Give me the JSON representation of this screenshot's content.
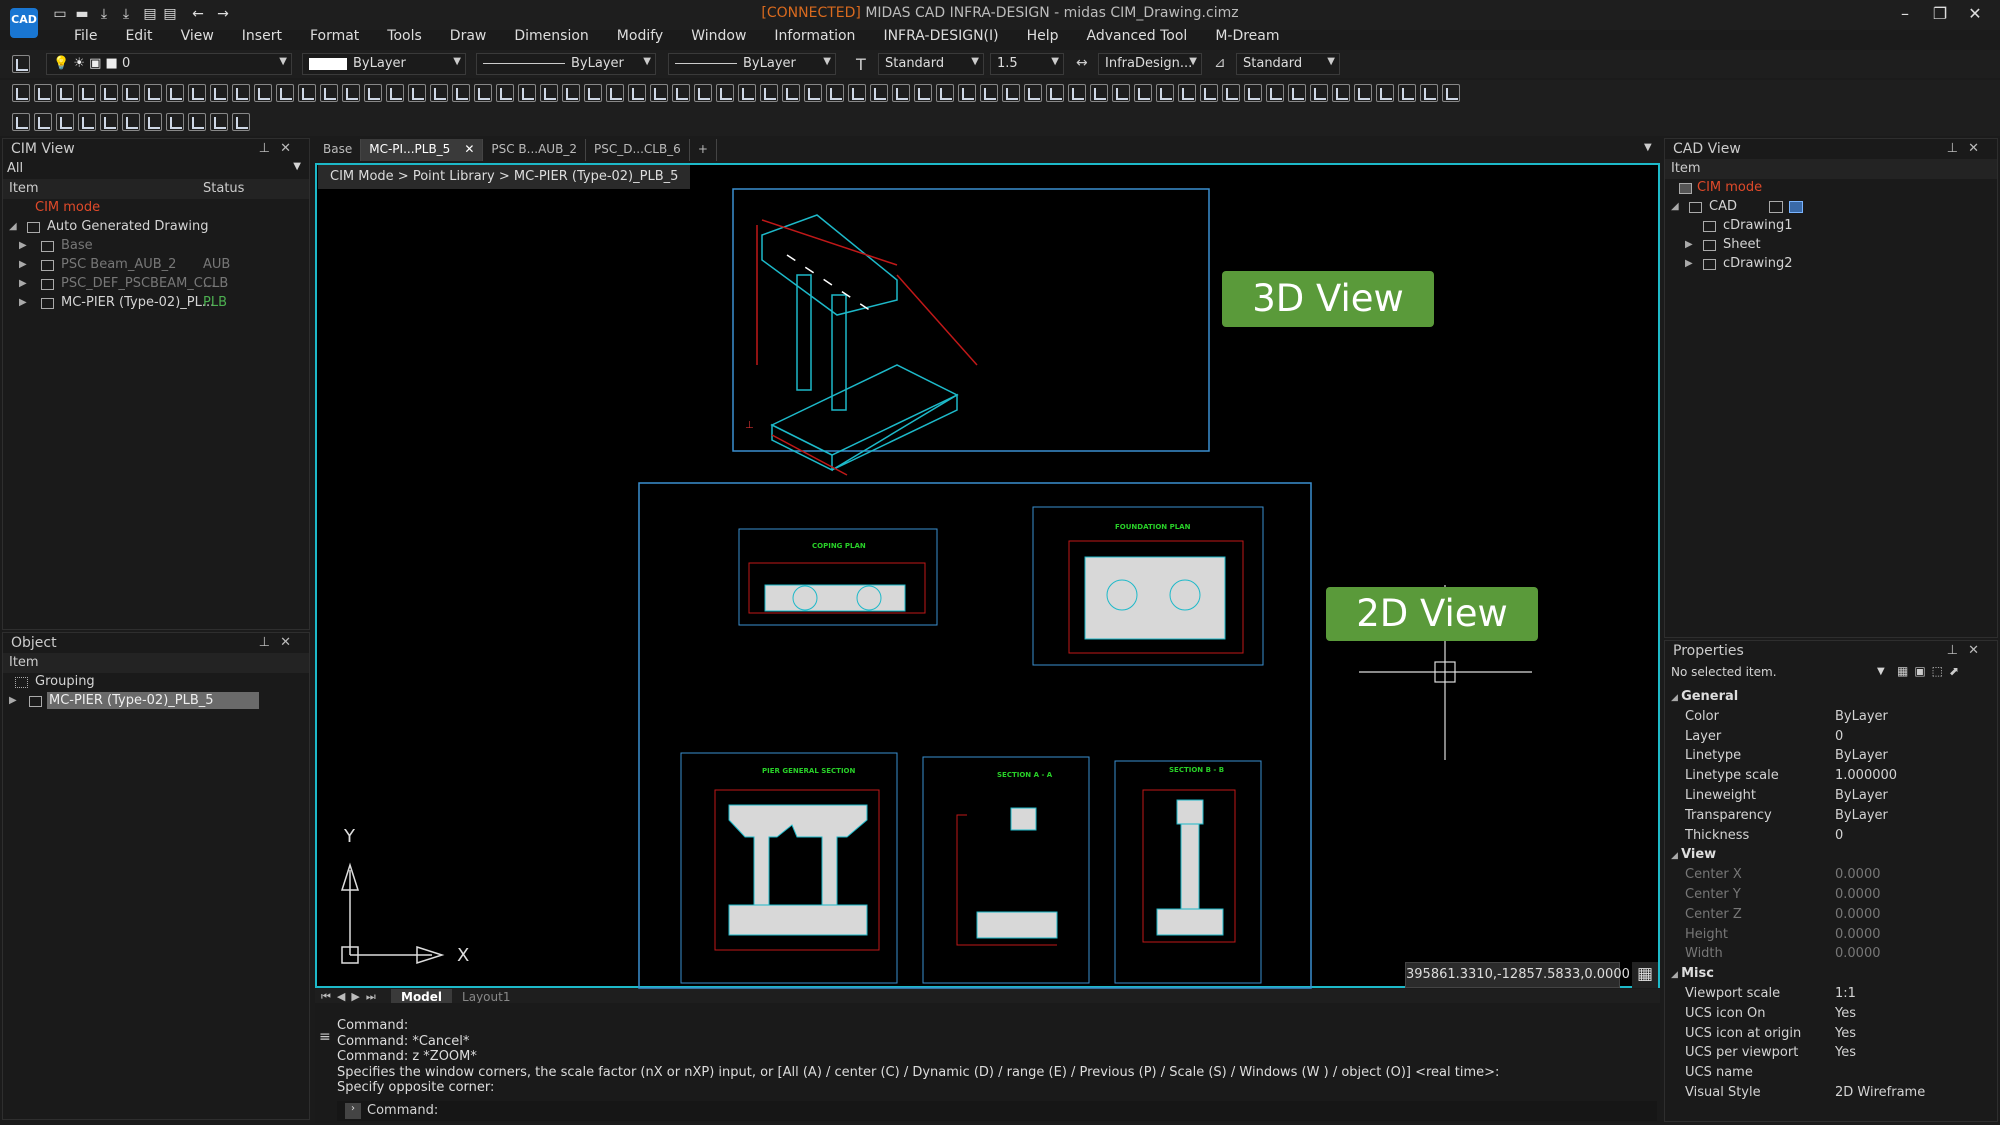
{
  "title": {
    "connected": "[CONNECTED]",
    "app": " MIDAS CAD INFRA-DESIGN - ",
    "file": "midas CIM_Drawing.cimz"
  },
  "logo": "CAD",
  "menu": [
    "File",
    "Edit",
    "View",
    "Insert",
    "Format",
    "Tools",
    "Draw",
    "Dimension",
    "Modify",
    "Window",
    "Information",
    "INFRA-DESIGN(I)",
    "Help",
    "Advanced Tool",
    "M-Dream"
  ],
  "toolbar": {
    "layer_value": "0",
    "color_value": "ByLayer",
    "linetype_value": "ByLayer",
    "lineweight_value": "ByLayer",
    "text_style": "Standard",
    "text_height": "1.5",
    "dim_style": "InfraDesign...",
    "table_style": "Standard"
  },
  "cim_view": {
    "title": "CIM View",
    "filter": "All",
    "col_item": "Item",
    "col_status": "Status",
    "mode_label": "CIM mode",
    "group_label": "Auto Generated Drawing",
    "items": [
      {
        "label": "Base",
        "status": ""
      },
      {
        "label": "PSC Beam_AUB_2",
        "status": "AUB"
      },
      {
        "label": "PSC_DEF_PSCBEAM_C...",
        "status": "CLB"
      },
      {
        "label": "MC-PIER (Type-02)_PL...",
        "status": "PLB"
      }
    ]
  },
  "object_panel": {
    "title": "Object",
    "col_item": "Item",
    "grouping": "Grouping",
    "selected": "MC-PIER (Type-02)_PLB_5"
  },
  "doc_tabs": [
    "Base",
    "MC-PI...PLB_5",
    "PSC B...AUB_2",
    "PSC_D...CLB_6",
    "+"
  ],
  "breadcrumb": "CIM Mode > Point Library > MC-PIER (Type-02)_PLB_5",
  "drawing": {
    "view3d_label": "3D View",
    "view2d_label": "2D View",
    "coping_plan": "COPING PLAN",
    "foundation_plan": "FOUNDATION PLAN",
    "pier_general": "PIER GENERAL SECTION",
    "section_aa": "SECTION A - A",
    "section_bb": "SECTION B - B",
    "ucs_x": "X",
    "ucs_y": "Y"
  },
  "coordinates": "395861.3310,-12857.5833,0.0000",
  "layout_tabs": [
    "Model",
    "Layout1"
  ],
  "command": {
    "lines": [
      "Command:",
      "Command: *Cancel*",
      "Command: z *ZOOM*",
      "Specifies the window corners, the scale factor (nX or nXP) input, or [All (A) / center (C) / Dynamic (D) / range (E) / Previous (P) / Scale (S) / Windows (W ) / object (O)] <real time>:",
      "Specify opposite corner:"
    ],
    "prompt": "Command:"
  },
  "cad_view": {
    "title": "CAD View",
    "col_item": "Item",
    "mode_label": "CIM mode",
    "cad_label": "CAD",
    "items": [
      "cDrawing1",
      "Sheet",
      "cDrawing2"
    ]
  },
  "properties": {
    "title": "Properties",
    "selection": "No selected item.",
    "general_label": "General",
    "general": [
      {
        "label": "Color",
        "value": "ByLayer"
      },
      {
        "label": "Layer",
        "value": "0"
      },
      {
        "label": "Linetype",
        "value": "ByLayer"
      },
      {
        "label": "Linetype scale",
        "value": "1.000000"
      },
      {
        "label": "Lineweight",
        "value": "ByLayer"
      },
      {
        "label": "Transparency",
        "value": "ByLayer"
      },
      {
        "label": "Thickness",
        "value": "0"
      }
    ],
    "view_label": "View",
    "view": [
      {
        "label": "Center X",
        "value": "0.0000"
      },
      {
        "label": "Center Y",
        "value": "0.0000"
      },
      {
        "label": "Center Z",
        "value": "0.0000"
      },
      {
        "label": "Height",
        "value": "0.0000"
      },
      {
        "label": "Width",
        "value": "0.0000"
      }
    ],
    "misc_label": "Misc",
    "misc": [
      {
        "label": "Viewport scale",
        "value": "1:1"
      },
      {
        "label": "UCS icon On",
        "value": "Yes"
      },
      {
        "label": "UCS icon at origin",
        "value": "Yes"
      },
      {
        "label": "UCS per viewport",
        "value": "Yes"
      },
      {
        "label": "UCS name",
        "value": ""
      },
      {
        "label": "Visual Style",
        "value": "2D Wireframe"
      }
    ]
  },
  "colors": {
    "accent_cyan": "#1db9c9",
    "label_green": "#5a9a3a",
    "cim_mode_red": "#e04a2a",
    "status_green": "#4caf50"
  }
}
